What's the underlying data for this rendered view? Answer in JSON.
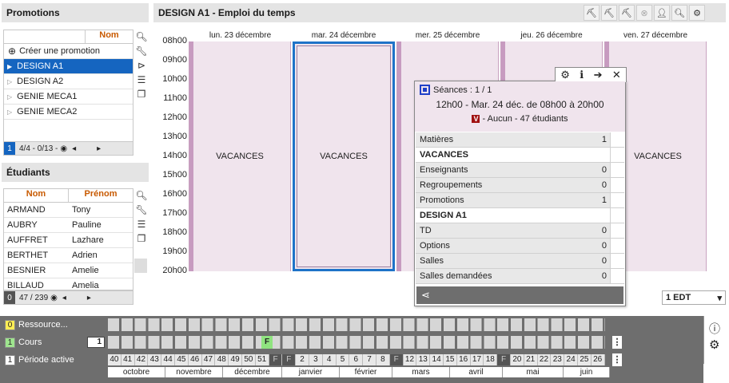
{
  "promotions": {
    "title": "Promotions",
    "col_header": "Nom",
    "create": "Créer une promotion",
    "items": [
      "DESIGN A1",
      "DESIGN A2",
      "GENIE MECA1",
      "GENIE MECA2"
    ],
    "status_num": "1",
    "status_count": "4/4 - 0/13 -"
  },
  "students": {
    "title": "Étudiants",
    "col_nom": "Nom",
    "col_prenom": "Prénom",
    "rows": [
      [
        "ARMAND",
        "Tony"
      ],
      [
        "AUBRY",
        "Pauline"
      ],
      [
        "AUFFRET",
        "Lazhare"
      ],
      [
        "BERTHET",
        "Adrien"
      ],
      [
        "BESNIER",
        "Amelie"
      ],
      [
        "BILLAUD",
        "Amelia"
      ]
    ],
    "status_num": "0",
    "status_count": "47 / 239"
  },
  "schedule": {
    "title": "DESIGN A1 - Emploi du temps",
    "days": [
      "lun. 23 décembre",
      "mar. 24 décembre",
      "mer. 25 décembre",
      "jeu. 26 décembre",
      "ven. 27 décembre"
    ],
    "hours": [
      "08h00",
      "09h00",
      "10h00",
      "11h00",
      "12h00",
      "13h00",
      "14h00",
      "15h00",
      "16h00",
      "17h00",
      "18h00",
      "19h00",
      "20h00"
    ],
    "event_label": "VACANCES",
    "edt_select": "1 EDT"
  },
  "popup": {
    "seances": "Séances : 1 / 1",
    "time": "12h00 - Mar. 24 déc. de 08h00 à 20h00",
    "badge": "V",
    "desc": "- Aucun - 47 étudiants",
    "rows": [
      {
        "label": "Matières",
        "value": "1",
        "style": "gray"
      },
      {
        "label": "VACANCES",
        "value": "",
        "style": "white"
      },
      {
        "label": "Enseignants",
        "value": "0",
        "style": "gray"
      },
      {
        "label": "Regroupements",
        "value": "0",
        "style": "gray"
      },
      {
        "label": "Promotions",
        "value": "1",
        "style": "gray"
      },
      {
        "label": "DESIGN A1",
        "value": "",
        "style": "white"
      },
      {
        "label": "TD",
        "value": "0",
        "style": "gray"
      },
      {
        "label": "Options",
        "value": "0",
        "style": "gray"
      },
      {
        "label": "Salles",
        "value": "0",
        "style": "gray"
      },
      {
        "label": "Salles demandées",
        "value": "0",
        "style": "gray"
      }
    ]
  },
  "bottom": {
    "r1_num": "0",
    "r1_label": "Ressource...",
    "r2_num": "1",
    "r2_label": "Cours",
    "r2_val": "1",
    "r3_num": "1",
    "r3_label": "Période active",
    "f_marker": "F",
    "weeks": [
      "40",
      "41",
      "42",
      "43",
      "44",
      "45",
      "46",
      "47",
      "48",
      "49",
      "50",
      "51",
      "F",
      "F",
      "2",
      "3",
      "4",
      "5",
      "6",
      "7",
      "8",
      "F",
      "12",
      "13",
      "14",
      "15",
      "16",
      "17",
      "18",
      "F",
      "20",
      "21",
      "22",
      "23",
      "24",
      "25",
      "26"
    ],
    "months": [
      "octobre",
      "novembre",
      "décembre",
      "janvier",
      "février",
      "mars",
      "avril",
      "mai",
      "juin"
    ]
  },
  "colors": {
    "accent": "#1565c0",
    "event": "#f0e4ed",
    "event_strip": "#c79bc0",
    "header_orange": "#c85a00",
    "bottom_bar": "#6e6e6e"
  }
}
